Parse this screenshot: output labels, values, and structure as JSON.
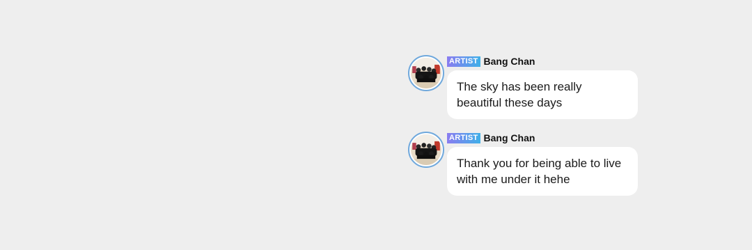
{
  "messages": [
    {
      "badge": "ARTIST",
      "author": "Bang Chan",
      "text": "The sky has been really beautiful these days"
    },
    {
      "badge": "ARTIST",
      "author": "Bang Chan",
      "text": "Thank you for being able to live with me under it hehe"
    }
  ],
  "colors": {
    "background": "#eeeeee",
    "bubble": "#ffffff",
    "badge_gradient_start": "#8a7cf0",
    "badge_gradient_end": "#3fb0e8",
    "avatar_ring": "#6fa8dc"
  }
}
